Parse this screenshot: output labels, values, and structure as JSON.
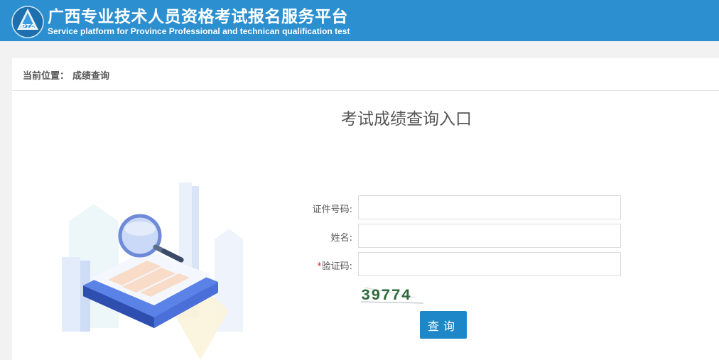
{
  "header": {
    "logo_text": "PTA",
    "title_cn": "广西专业技术人员资格考试报名服务平台",
    "title_en": "Service platform for Province Professional and technican qualification test"
  },
  "breadcrumb": {
    "label": "当前位置：",
    "current": "成绩查询"
  },
  "page": {
    "heading": "考试成绩查询入口"
  },
  "form": {
    "id_label": "证件号码:",
    "id_value": "",
    "name_label": "姓名:",
    "name_value": "",
    "required_mark": "*",
    "captcha_label": "验证码:",
    "captcha_value": "",
    "captcha_image_text": "39774",
    "submit_label": "查询"
  },
  "colors": {
    "header_bg": "#2b8fd0",
    "button_bg": "#1e87c8",
    "required": "#e03030"
  }
}
